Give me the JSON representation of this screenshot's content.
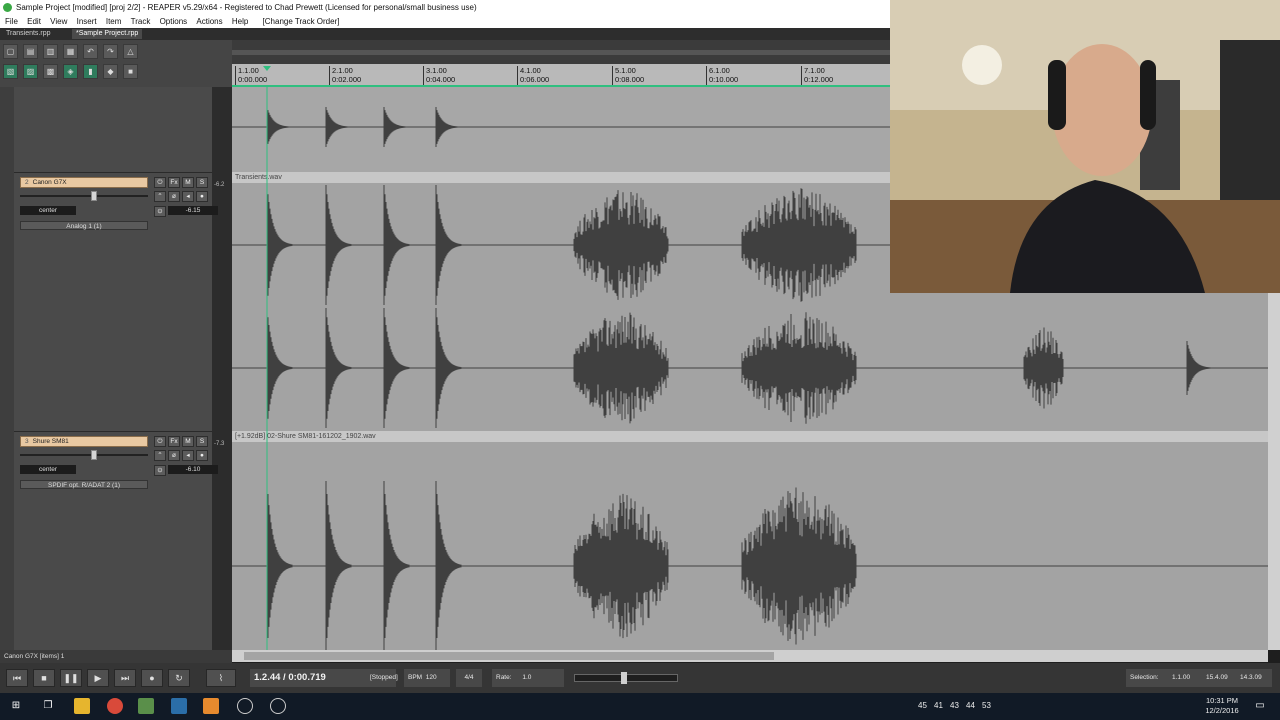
{
  "window": {
    "title": "Sample Project [modified] [proj 2/2] - REAPER v5.29/x64 - Registered to Chad Prewett (Licensed for personal/small business use)"
  },
  "menu": [
    "File",
    "Edit",
    "View",
    "Insert",
    "Item",
    "Track",
    "Options",
    "Actions",
    "Help",
    "[Change Track Order]"
  ],
  "project_tabs": [
    {
      "label": "Transients.rpp",
      "active": false
    },
    {
      "label": "*Sample Project.rpp",
      "active": true
    }
  ],
  "ruler": [
    {
      "bar": "1.1.00",
      "time": "0:00.000"
    },
    {
      "bar": "2.1.00",
      "time": "0:02.000"
    },
    {
      "bar": "3.1.00",
      "time": "0:04.000"
    },
    {
      "bar": "4.1.00",
      "time": "0:06.000"
    },
    {
      "bar": "5.1.00",
      "time": "0:08.000"
    },
    {
      "bar": "6.1.00",
      "time": "0:10.000"
    },
    {
      "bar": "7.1.00",
      "time": "0:12.000"
    }
  ],
  "tracks": [
    {
      "number": "2",
      "name": "Canon G7X",
      "buttons": [
        "Fx",
        "M",
        "S"
      ],
      "pan": "center",
      "volume": "-6.15",
      "input": "Analog 1 (1)",
      "meter_label": "-6.2",
      "item_label": "Transients.wav",
      "vol_level": 0.58
    },
    {
      "number": "3",
      "name": "Shure SM81",
      "buttons": [
        "Fx",
        "M",
        "S"
      ],
      "pan": "center",
      "volume": "-6.10",
      "input": "SPDIF opt. R/ADAT 2 (1)",
      "meter_label": "-7.3",
      "item_label": "[+1.92dB] 02-Shure SM81-161202_1902.wav",
      "vol_level": 0.58
    }
  ],
  "status": {
    "selection_info": "Canon G7X [items] 1"
  },
  "transport": {
    "position": "1.2.44 / 0:00.719",
    "state": "[Stopped]",
    "bpm_label": "BPM",
    "bpm": "120",
    "time_sig": "4/4",
    "rate_label": "Rate:",
    "rate": "1.0",
    "selection_label": "Selection:",
    "sel_start": "1.1.00",
    "sel_end": "15.4.09",
    "sel_length": "14.3.09"
  },
  "taskbar": {
    "tray_numbers": [
      "45",
      "41",
      "43",
      "44",
      "53"
    ],
    "time": "10:31 PM",
    "date": "12/2/2016"
  },
  "colors": {
    "track_name_bg": "#e9c9a2",
    "play_cursor": "#2fbf7f",
    "waveform": "#404040",
    "lane_bg": "#a3a3a3"
  }
}
